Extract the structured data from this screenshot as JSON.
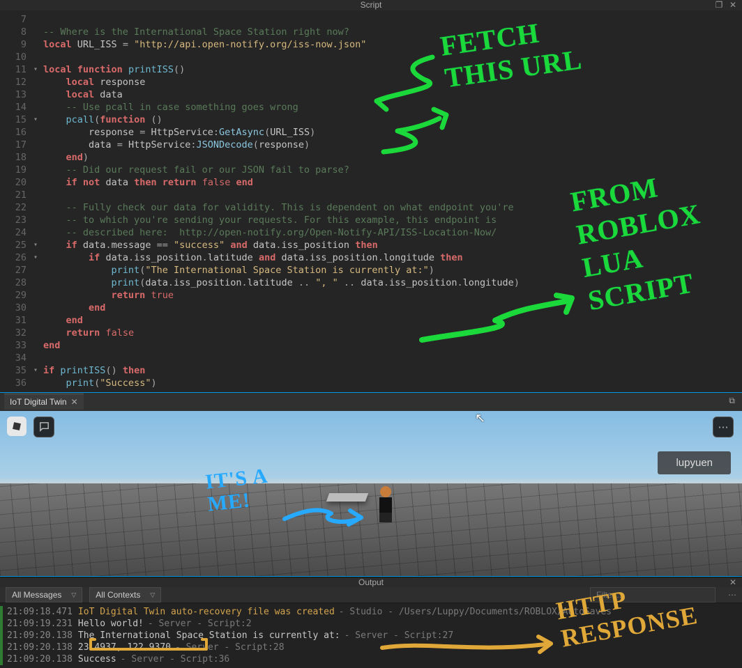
{
  "window": {
    "title": "Script"
  },
  "code": {
    "lines": [
      {
        "n": 7,
        "fold": "",
        "html": ""
      },
      {
        "n": 8,
        "fold": "",
        "html": "<span class='tk-comment'>-- Where is the International Space Station right now?</span>"
      },
      {
        "n": 9,
        "fold": "",
        "html": "<span class='tk-keyword'>local</span> <span class='tk-ident'>URL_ISS</span> <span class='tk-op'>=</span> <span class='tk-string'>\"http://api.open-notify.org/iss-now.json\"</span>"
      },
      {
        "n": 10,
        "fold": "",
        "html": ""
      },
      {
        "n": 11,
        "fold": "▾",
        "html": "<span class='tk-keyword'>local</span> <span class='tk-keyword'>function</span> <span class='tk-func'>printISS</span><span class='tk-op'>()</span>"
      },
      {
        "n": 12,
        "fold": "",
        "html": "    <span class='tk-keyword'>local</span> <span class='tk-ident'>response</span>"
      },
      {
        "n": 13,
        "fold": "",
        "html": "    <span class='tk-keyword'>local</span> <span class='tk-ident'>data</span>"
      },
      {
        "n": 14,
        "fold": "",
        "html": "    <span class='tk-comment'>-- Use pcall in case something goes wrong</span>"
      },
      {
        "n": 15,
        "fold": "▾",
        "html": "    <span class='tk-func'>pcall</span><span class='tk-op'>(</span><span class='tk-keyword'>function</span> <span class='tk-op'>()</span>"
      },
      {
        "n": 16,
        "fold": "",
        "html": "        <span class='tk-ident'>response</span> <span class='tk-op'>=</span> <span class='tk-ident'>HttpService</span><span class='tk-op'>:</span><span class='tk-method'>GetAsync</span><span class='tk-op'>(</span><span class='tk-ident'>URL_ISS</span><span class='tk-op'>)</span>"
      },
      {
        "n": 17,
        "fold": "",
        "html": "        <span class='tk-ident'>data</span> <span class='tk-op'>=</span> <span class='tk-ident'>HttpService</span><span class='tk-op'>:</span><span class='tk-method'>JSONDecode</span><span class='tk-op'>(</span><span class='tk-ident'>response</span><span class='tk-op'>)</span>"
      },
      {
        "n": 18,
        "fold": "",
        "html": "    <span class='tk-keyword'>end</span><span class='tk-op'>)</span>"
      },
      {
        "n": 19,
        "fold": "",
        "html": "    <span class='tk-comment'>-- Did our request fail or our JSON fail to parse?</span>"
      },
      {
        "n": 20,
        "fold": "",
        "html": "    <span class='tk-keyword'>if</span> <span class='tk-keyword'>not</span> <span class='tk-ident'>data</span> <span class='tk-keyword'>then</span> <span class='tk-keyword'>return</span> <span class='tk-bool'>false</span> <span class='tk-keyword'>end</span>"
      },
      {
        "n": 21,
        "fold": "",
        "html": ""
      },
      {
        "n": 22,
        "fold": "",
        "html": "    <span class='tk-comment'>-- Fully check our data for validity. This is dependent on what endpoint you're</span>"
      },
      {
        "n": 23,
        "fold": "",
        "html": "    <span class='tk-comment'>-- to which you're sending your requests. For this example, this endpoint is</span>"
      },
      {
        "n": 24,
        "fold": "",
        "html": "    <span class='tk-comment'>-- described here:  http://open-notify.org/Open-Notify-API/ISS-Location-Now/</span>"
      },
      {
        "n": 25,
        "fold": "▾",
        "html": "    <span class='tk-keyword'>if</span> <span class='tk-ident'>data</span><span class='tk-op'>.</span><span class='tk-ident'>message</span> <span class='tk-op'>==</span> <span class='tk-string'>\"success\"</span> <span class='tk-keyword'>and</span> <span class='tk-ident'>data</span><span class='tk-op'>.</span><span class='tk-ident'>iss_position</span> <span class='tk-keyword'>then</span>"
      },
      {
        "n": 26,
        "fold": "▾",
        "html": "        <span class='tk-keyword'>if</span> <span class='tk-ident'>data</span><span class='tk-op'>.</span><span class='tk-ident'>iss_position</span><span class='tk-op'>.</span><span class='tk-ident'>latitude</span> <span class='tk-keyword'>and</span> <span class='tk-ident'>data</span><span class='tk-op'>.</span><span class='tk-ident'>iss_position</span><span class='tk-op'>.</span><span class='tk-ident'>longitude</span> <span class='tk-keyword'>then</span>"
      },
      {
        "n": 27,
        "fold": "",
        "html": "            <span class='tk-func'>print</span><span class='tk-op'>(</span><span class='tk-string'>\"The International Space Station is currently at:\"</span><span class='tk-op'>)</span>"
      },
      {
        "n": 28,
        "fold": "",
        "html": "            <span class='tk-func'>print</span><span class='tk-op'>(</span><span class='tk-ident'>data</span><span class='tk-op'>.</span><span class='tk-ident'>iss_position</span><span class='tk-op'>.</span><span class='tk-ident'>latitude</span> <span class='tk-op'>..</span> <span class='tk-string'>\", \"</span> <span class='tk-op'>..</span> <span class='tk-ident'>data</span><span class='tk-op'>.</span><span class='tk-ident'>iss_position</span><span class='tk-op'>.</span><span class='tk-ident'>longitude</span><span class='tk-op'>)</span>"
      },
      {
        "n": 29,
        "fold": "",
        "html": "            <span class='tk-keyword'>return</span> <span class='tk-bool'>true</span>"
      },
      {
        "n": 30,
        "fold": "",
        "html": "        <span class='tk-keyword'>end</span>"
      },
      {
        "n": 31,
        "fold": "",
        "html": "    <span class='tk-keyword'>end</span>"
      },
      {
        "n": 32,
        "fold": "",
        "html": "    <span class='tk-keyword'>return</span> <span class='tk-bool'>false</span>"
      },
      {
        "n": 33,
        "fold": "",
        "html": "<span class='tk-keyword'>end</span>"
      },
      {
        "n": 34,
        "fold": "",
        "html": ""
      },
      {
        "n": 35,
        "fold": "▾",
        "html": "<span class='tk-keyword'>if</span> <span class='tk-func'>printISS</span><span class='tk-op'>()</span> <span class='tk-keyword'>then</span>"
      },
      {
        "n": 36,
        "fold": "",
        "html": "    <span class='tk-func'>print</span><span class='tk-op'>(</span><span class='tk-string'>\"Success\"</span><span class='tk-op'>)</span>"
      }
    ]
  },
  "viewport": {
    "tab_label": "IoT Digital Twin",
    "user_tag": "lupyuen"
  },
  "output": {
    "title": "Output",
    "dropdown_messages": "All Messages",
    "dropdown_contexts": "All Contexts",
    "filter_placeholder": "Filter...",
    "lines": [
      {
        "ts": "21:09:18.471",
        "msg": "IoT Digital Twin auto-recovery file was created",
        "cls": "out-warn",
        "src": "  -  Studio - /Users/Luppy/Documents/ROBLOX/AutoSaves"
      },
      {
        "ts": "21:09:19.231",
        "msg": "Hello world!",
        "cls": "out-msg",
        "src": "  -  Server - Script:2"
      },
      {
        "ts": "21:09:20.138",
        "msg": "The International Space Station is currently at:",
        "cls": "out-msg",
        "src": "  -  Server - Script:27"
      },
      {
        "ts": "21:09:20.138",
        "msg": "23.4937, 122.9370",
        "cls": "out-msg",
        "src": "  -  Server - Script:28"
      },
      {
        "ts": "21:09:20.138",
        "msg": "Success",
        "cls": "out-msg",
        "src": "  -  Server - Script:36"
      }
    ]
  },
  "annotations": {
    "fetch_url": "FETCH\nTHIS URL",
    "from_roblox": "FROM\nROBLOX\nLUA\nSCRIPT",
    "its_a_me": "IT'S A\nME!",
    "http_response": "HTTP\nRESPONSE"
  }
}
